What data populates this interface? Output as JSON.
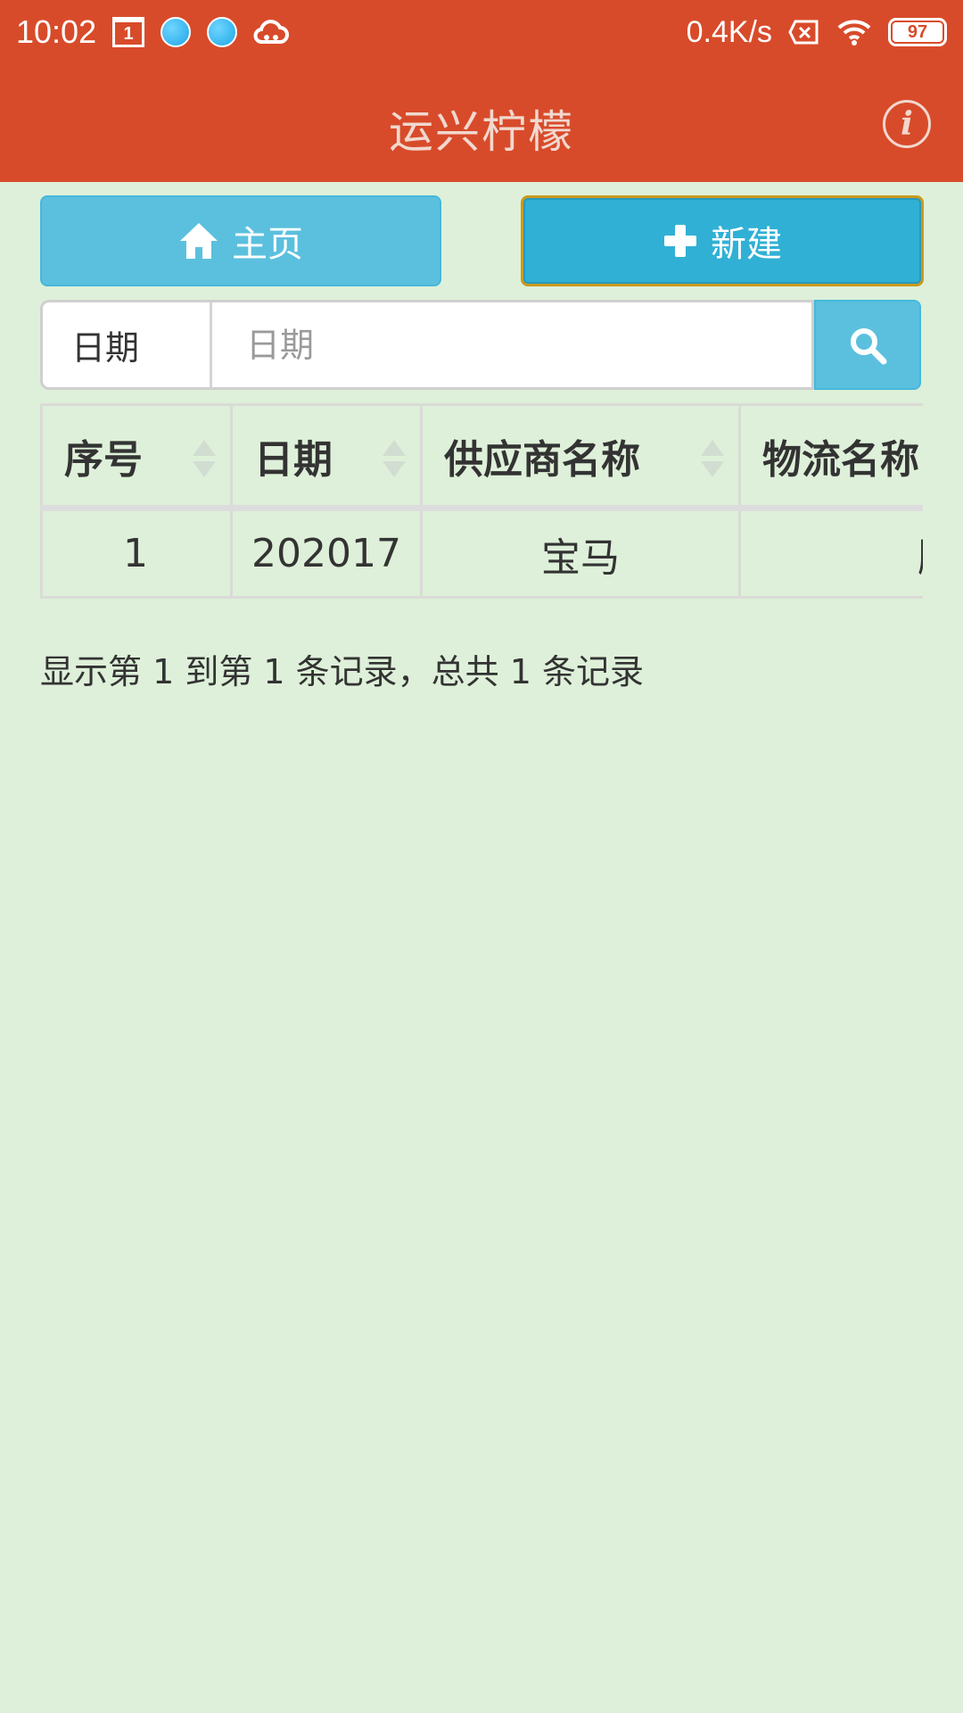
{
  "status_bar": {
    "time": "10:02",
    "calendar_day": "1",
    "network_speed": "0.4K/s",
    "battery": "97"
  },
  "app_bar": {
    "title": "运兴柠檬",
    "info_glyph": "i"
  },
  "actions": {
    "home_label": "主页",
    "new_label": "新建"
  },
  "search": {
    "field_label": "日期",
    "placeholder": "日期",
    "value": ""
  },
  "table": {
    "columns": [
      "序号",
      "日期",
      "供应商名称",
      "物流名称"
    ],
    "rows": [
      {
        "index": "1",
        "date": "202017",
        "supplier": "宝马",
        "logistics": "顺丰"
      }
    ]
  },
  "record_info": "显示第 1 到第 1 条记录，总共 1 条记录",
  "colors": {
    "header_bg": "#d84b2a",
    "page_bg": "#def0d9",
    "button_info": "#5bc0de",
    "button_info_active": "#31b0d5"
  }
}
